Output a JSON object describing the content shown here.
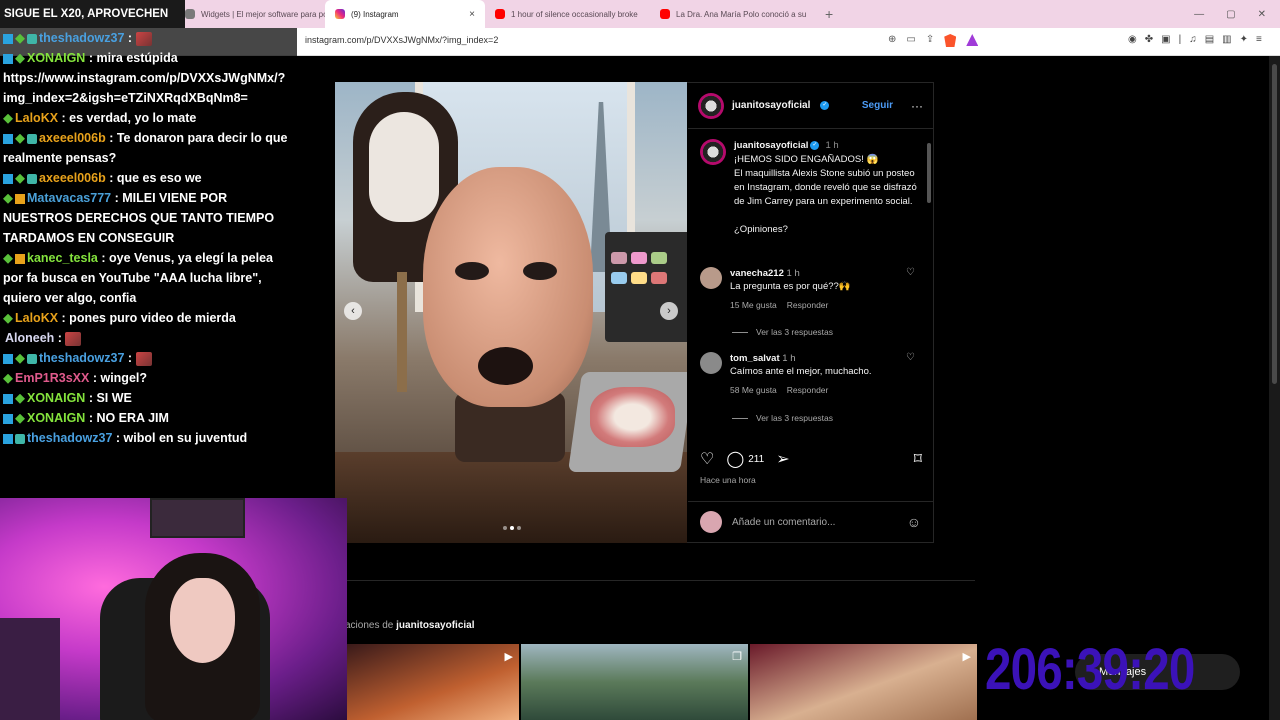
{
  "browser": {
    "tabs": [
      {
        "title": "Widgets | El mejor software para pot",
        "fav_color": "#7a7a7a"
      },
      {
        "title": "(9) Instagram",
        "fav_color": "#e1306c",
        "active": true
      },
      {
        "title": "1 hour of silence occasionally broke",
        "fav_color": "#ff0000"
      },
      {
        "title": "La Dra. Ana María Polo conoció a su",
        "fav_color": "#ff0000"
      }
    ],
    "new_tab": "+",
    "url": "instagram.com/p/DVXXsJWgNMx/?img_index=2"
  },
  "stream": {
    "banner": "SIGUE EL X20, APROVECHEN",
    "timer": "206:39:20",
    "message_button": "Mensajes"
  },
  "chat": [
    {
      "user": "theshadowz37",
      "color": "#49a0e0",
      "text": ":",
      "badges": [
        "b1",
        "b2",
        "b3"
      ],
      "emote": true
    },
    {
      "user": "XONAIGN",
      "color": "#84e33d",
      "text": ": mira estúpida https://www.instagram.com/p/DVXXsJWgNMx/?img_index=2&igsh=eTZiNXRqdXBqNm8=",
      "badges": [
        "b1",
        "b2"
      ]
    },
    {
      "user": "LaloKX",
      "color": "#e8a21b",
      "text": ": es verdad, yo lo mate",
      "badges": [
        "b2"
      ]
    },
    {
      "user": "axeeel006b",
      "color": "#e8a21b",
      "text": ": Te donaron para decir lo que realmente pensas?",
      "badges": [
        "b1",
        "b2",
        "b3"
      ]
    },
    {
      "user": "axeeel006b",
      "color": "#e8a21b",
      "text": ": que es eso we",
      "badges": [
        "b1",
        "b2",
        "b3"
      ]
    },
    {
      "user": "Matavacas777",
      "color": "#4aa0d8",
      "text": ": MILEI VIENE POR NUESTROS DERECHOS QUE TANTO TIEMPO TARDAMOS EN CONSEGUIR",
      "badges": [
        "b2",
        "b4"
      ]
    },
    {
      "user": "kanec_tesla",
      "color": "#84e33d",
      "text": ": oye Venus, ya elegí la pelea por fa busca en YouTube \"AAA lucha libre\", quiero ver algo, confia",
      "badges": [
        "b2",
        "b4"
      ]
    },
    {
      "user": "LaloKX",
      "color": "#e8a21b",
      "text": ": pones puro video de mierda",
      "badges": [
        "b2"
      ]
    },
    {
      "user": "Aloneeh",
      "color": "#d8d8f0",
      "text": ":",
      "badges": [],
      "emote": true
    },
    {
      "user": "theshadowz37",
      "color": "#49a0e0",
      "text": ":",
      "badges": [
        "b1",
        "b2",
        "b3"
      ],
      "emote": true
    },
    {
      "user": "EmP1R3sXX",
      "color": "#e05a8c",
      "text": ": wingel?",
      "badges": [
        "b2"
      ]
    },
    {
      "user": "XONAIGN",
      "color": "#84e33d",
      "text": ": SI WE",
      "badges": [
        "b1",
        "b2"
      ]
    },
    {
      "user": "XONAIGN",
      "color": "#84e33d",
      "text": ": NO ERA JIM",
      "badges": [
        "b1",
        "b2"
      ]
    },
    {
      "user": "theshadowz37",
      "color": "#49a0e0",
      "text": ": wibol en su juventud",
      "badges": [
        "b1",
        "b3"
      ]
    }
  ],
  "post": {
    "username": "juanitosayoficial",
    "follow_label": "Seguir",
    "more": "···",
    "caption_time": "1 h",
    "caption_lines": [
      "¡HEMOS SIDO ENGAÑADOS! 😱",
      "El maquillista Alexis Stone subió un posteo en Instagram, donde reveló que se disfrazó de Jim Carrey para un experimento social.",
      "",
      "¿Opiniones?"
    ],
    "comments": [
      {
        "user": "vanecha212",
        "time": "1 h",
        "text": "La pregunta es por qué??🙌",
        "likes": "15 Me gusta",
        "reply": "Responder",
        "replies": "Ver las 3 respuestas",
        "ph_color": "#b89a8a"
      },
      {
        "user": "tom_salvat",
        "time": "1 h",
        "text": "Caímos ante el mejor, muchacho.",
        "likes": "58 Me gusta",
        "reply": "Responder",
        "replies": "Ver las 3 respuestas",
        "ph_color": "#8a8a8a"
      }
    ],
    "comment_count": "211",
    "posted": "Hace una hora",
    "add_comment_placeholder": "Añade un comentario...",
    "more_from_prefix": "aciones de",
    "more_from_user": "juanitosayoficial",
    "carousel_index": 2,
    "carousel_total": 3
  },
  "icons": {
    "heart": "♡",
    "comment": "◯",
    "share": "➢",
    "bookmark": "⌑",
    "emoji": "☺",
    "prev": "‹",
    "next": "›",
    "close": "×"
  }
}
